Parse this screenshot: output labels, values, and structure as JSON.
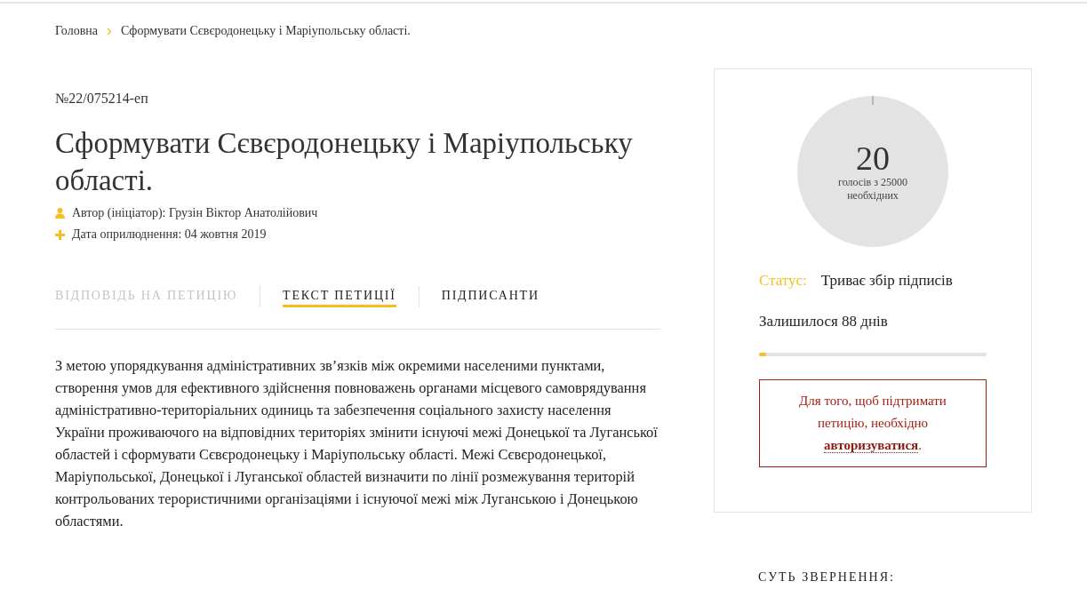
{
  "breadcrumb": [
    {
      "label": "Головна"
    },
    {
      "label": "Сформувати Сєвєродонецьку і Маріупольську області."
    }
  ],
  "petition": {
    "number": "№22/075214-еп",
    "title": "Сформувати Сєвєродонецьку і Маріупольську області.",
    "meta": [
      {
        "kind": "author",
        "text": "Автор (ініціатор): Грузін Віктор Анатолійович"
      },
      {
        "kind": "date",
        "text": "Дата оприлюднення: 04 жовтня 2019"
      }
    ],
    "tabs": [
      {
        "label": "ВІДПОВІДЬ НА ПЕТИЦІЮ",
        "selected": false,
        "disabled": true
      },
      {
        "label": "ТЕКСТ ПЕТИЦІЇ",
        "selected": true,
        "disabled": false
      },
      {
        "label": "ПІДПИСАНТИ",
        "selected": false,
        "disabled": false
      }
    ],
    "text": "З метою упорядкування адміністративних зв’язків між окремими населеними пунктами, створення умов для ефективного здійснення повноважень органами місцевого самоврядування адміністративно-територіальних одиниць та забезпечення соціального захисту населення України проживаючого на відповідних територіях змінити існуючі межі Донецької та Луганської областей і сформувати Сєвєродонецьку і Маріупольську області. Межі Сєвєродонецької, Маріупольської, Донецької і Луганської областей визначити по лінії розмежування територій контрольованих терористичними організаціями і існуючої межі між Луганською і Донецькою областями."
  },
  "sidebar": {
    "votes": {
      "count": "20",
      "caption_1": "голосів з 25000",
      "caption_2": "необхідних"
    },
    "status_label": "Статус:",
    "status": "Триває збір підписів",
    "remaining": "Залишилося 88 днів",
    "time": {
      "level": 0.03
    },
    "notice": {
      "text": "Для того, щоб підтримати петицію, необхідно",
      "link": "авторизуватися",
      "end": "."
    },
    "essence_title": "СУТЬ ЗВЕРНЕННЯ:"
  }
}
